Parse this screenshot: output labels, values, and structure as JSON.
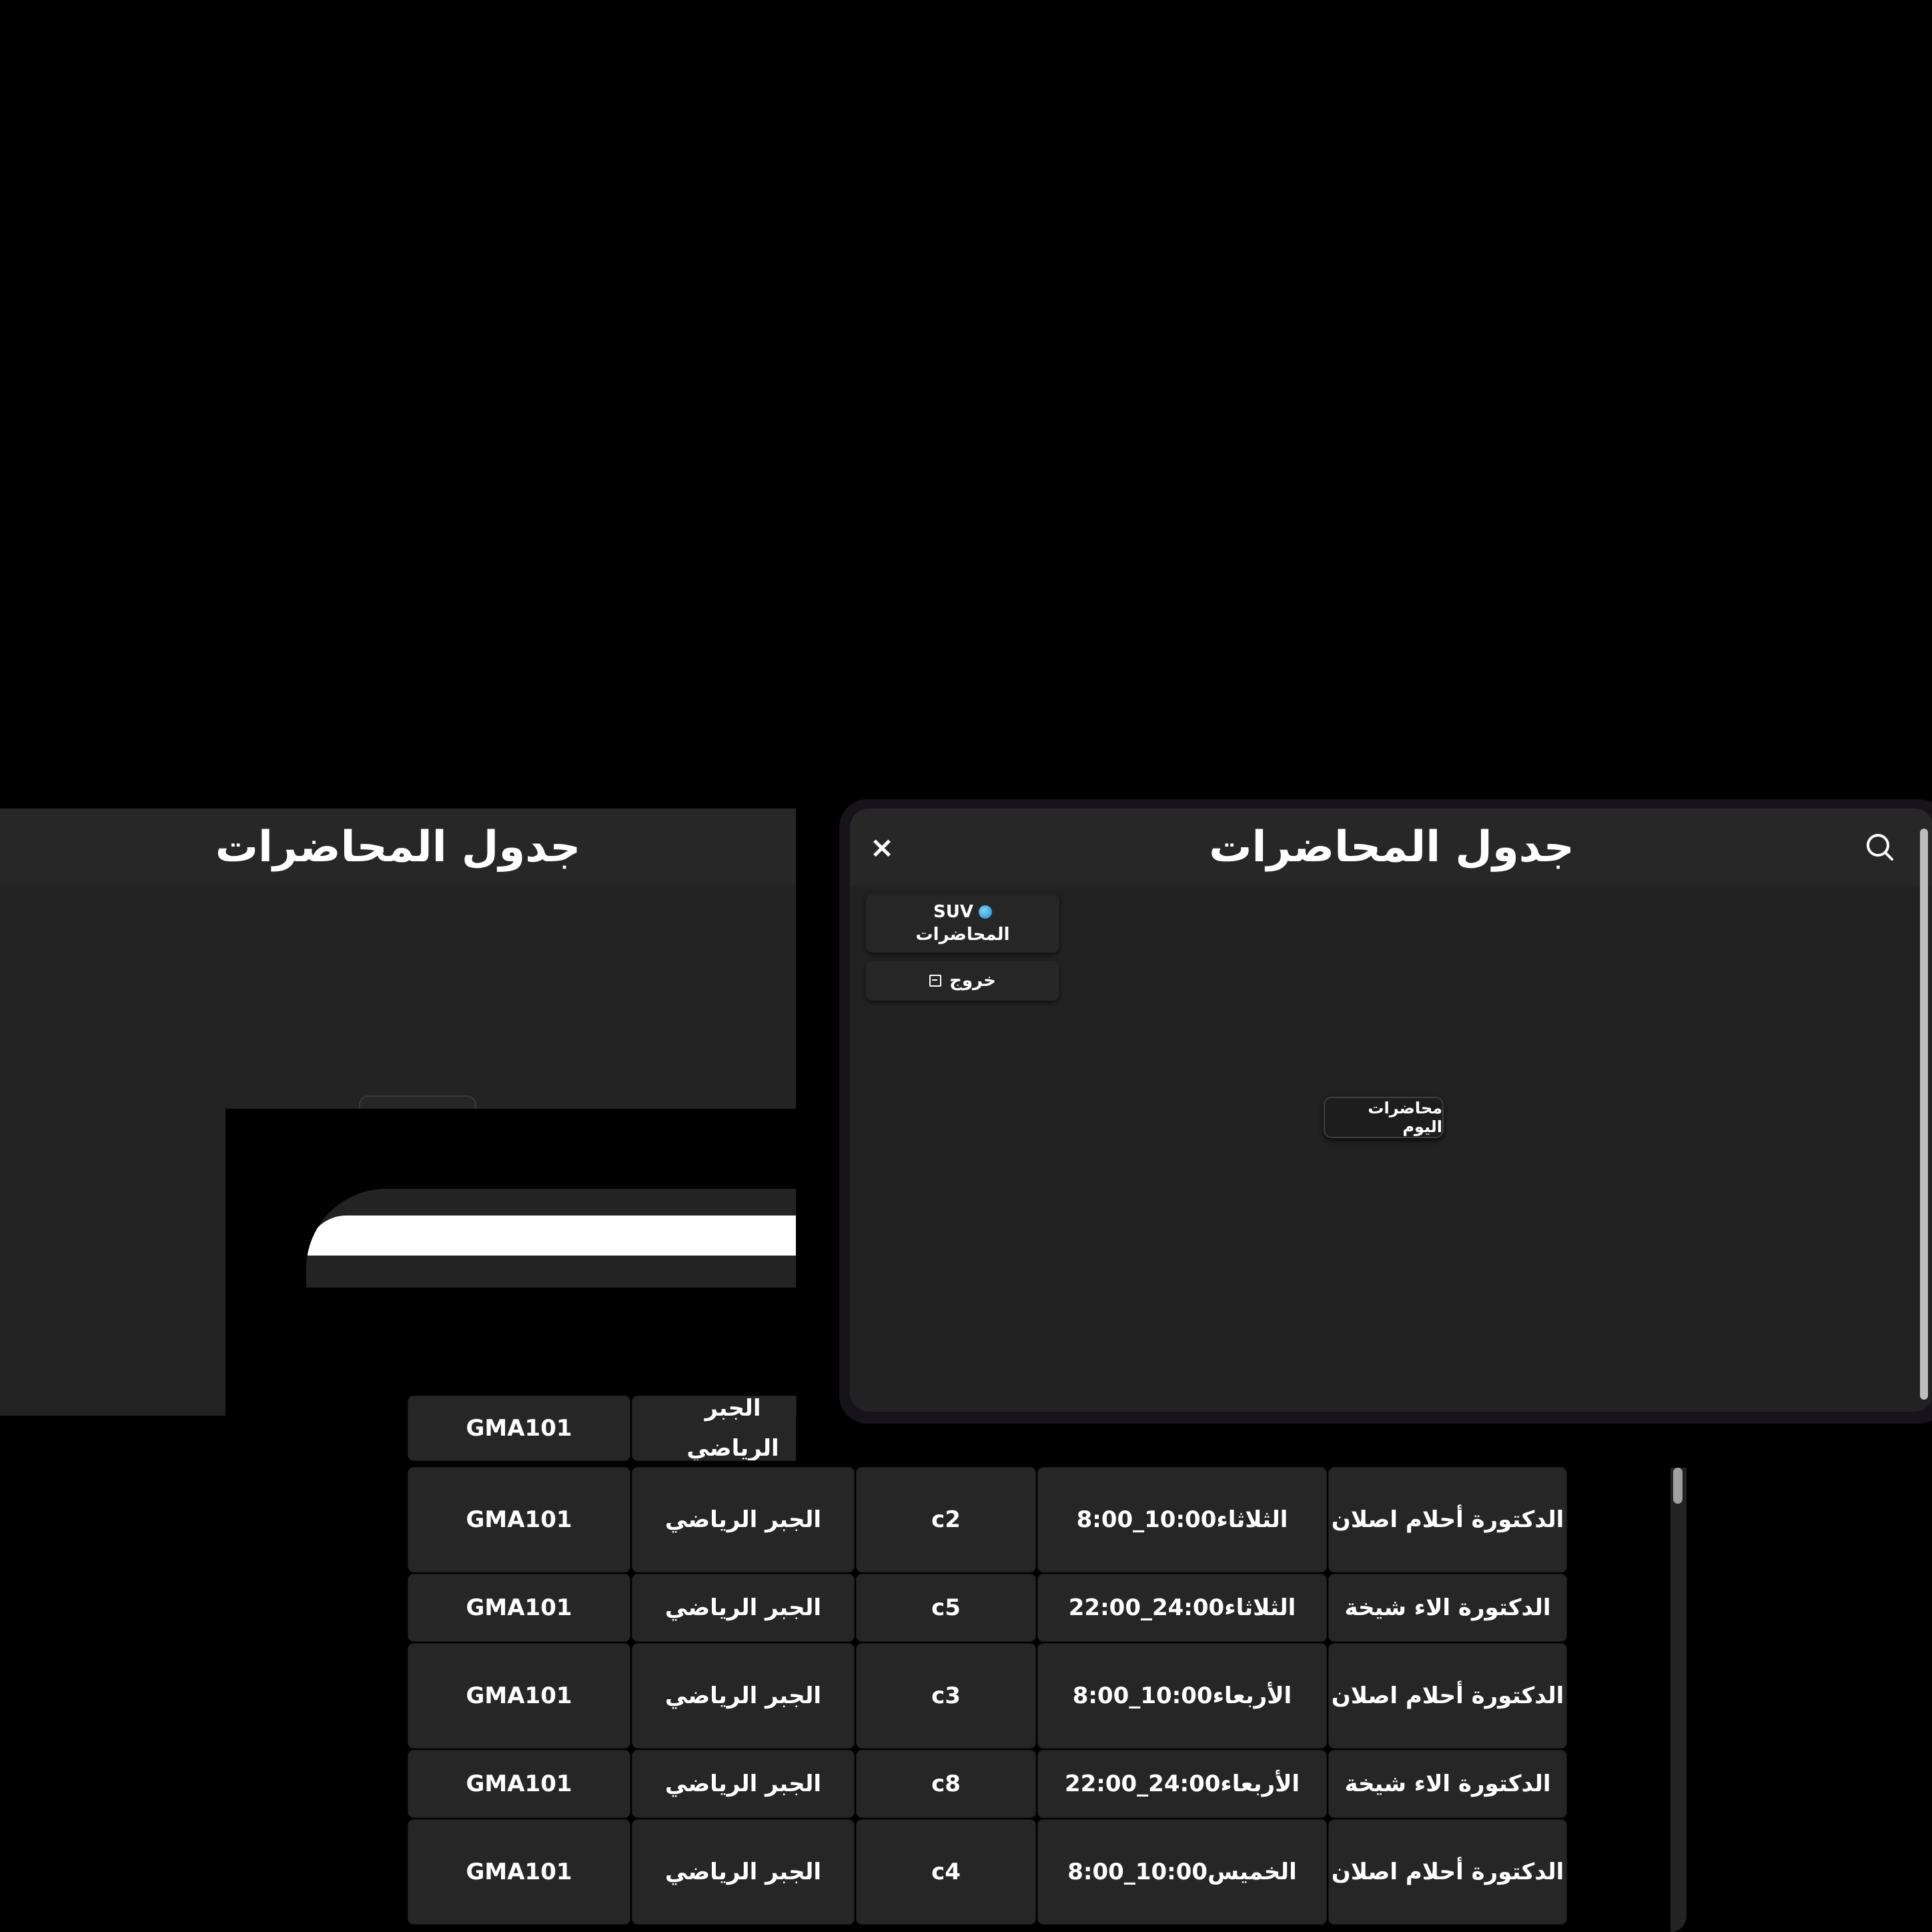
{
  "page_title": "جدول المحاضرات",
  "modal": {
    "title": "جدول المحاضرات",
    "close_label": "×",
    "menu": {
      "lectures_top": "SUV",
      "lectures_label": "المحاضرات",
      "logout_label": "خروج"
    },
    "today_button": "محاضرات اليوم"
  },
  "partial_row": {
    "code": "GMA101",
    "subject": "الجبر الرياضي"
  },
  "rows": [
    {
      "code": "GMA101",
      "subject": "الجبر الرياضي",
      "room": "c2",
      "time": "الثلاثاء 8:00_10:00",
      "doctor": "الدكتورة أحلام اصلان"
    },
    {
      "code": "GMA101",
      "subject": "الجبر الرياضي",
      "room": "c5",
      "time": "الثلاثاء 22:00_24:00",
      "doctor": "الدكتورة الاء شيخة"
    },
    {
      "code": "GMA101",
      "subject": "الجبر الرياضي",
      "room": "c3",
      "time": "الأربعاء 8:00_10:00",
      "doctor": "الدكتورة أحلام اصلان"
    },
    {
      "code": "GMA101",
      "subject": "الجبر الرياضي",
      "room": "c8",
      "time": "الأربعاء 22:00_24:00",
      "doctor": "الدكتورة الاء شيخة"
    },
    {
      "code": "GMA101",
      "subject": "الجبر الرياضي",
      "room": "c4",
      "time": "الخميس 8:00_10:00",
      "doctor": "الدكتورة أحلام اصلان"
    }
  ],
  "colors": {
    "background": "#000000",
    "panel": "#222222",
    "header": "#272727",
    "cell": "#262626",
    "modal_frame": "#16131a"
  }
}
